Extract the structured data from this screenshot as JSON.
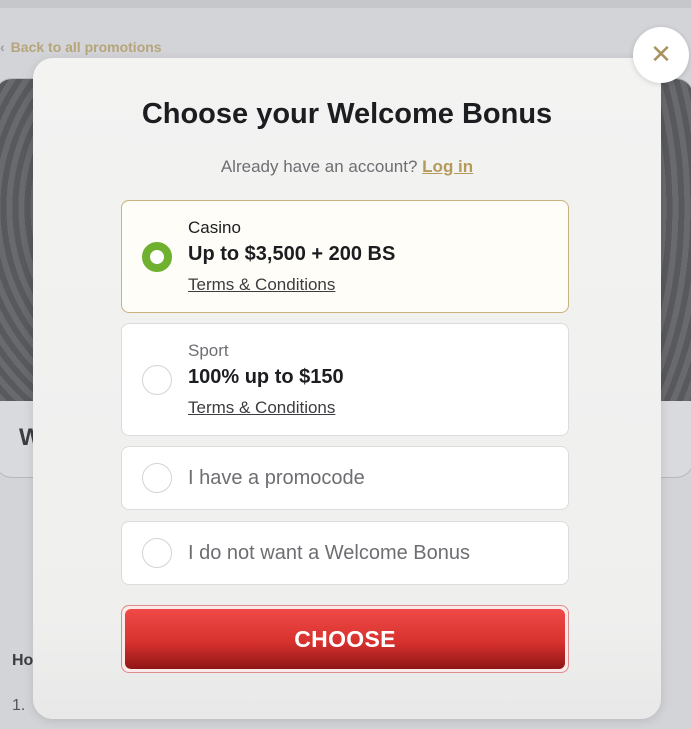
{
  "background": {
    "back_link": "Back to all promotions",
    "card_title_partial": "W",
    "how_heading_partial": "Ho",
    "step_partial": "1."
  },
  "modal": {
    "title": "Choose your Welcome Bonus",
    "account_prompt": "Already have an account?",
    "login_label": "Log in",
    "close_icon": "close-icon",
    "options": [
      {
        "category": "Casino",
        "amount": "Up to $3,500 + 200 BS",
        "terms": "Terms & Conditions",
        "selected": true
      },
      {
        "category": "Sport",
        "amount": "100% up to $150",
        "terms": "Terms & Conditions",
        "selected": false
      },
      {
        "label": "I have a promocode",
        "selected": false
      },
      {
        "label": "I do not want a Welcome Bonus",
        "selected": false
      }
    ],
    "choose_label": "CHOOSE"
  },
  "colors": {
    "accent_gold": "#b69a5b",
    "radio_selected": "#6fb12f",
    "button_red": "#d8322f"
  }
}
